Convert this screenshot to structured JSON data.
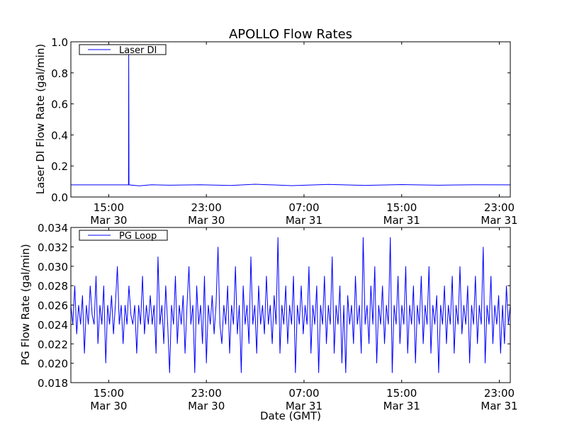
{
  "title": "APOLLO Flow Rates",
  "chart_data": [
    {
      "type": "line",
      "title": "APOLLO Flow Rates",
      "xlabel": "",
      "ylabel": "Laser DI Flow Rate (gal/min)",
      "x_unit": "hours since Mar 30 00:00 GMT",
      "xlim": [
        11.9,
        47.9
      ],
      "ylim": [
        0.0,
        1.0
      ],
      "yticks": [
        "0.0",
        "0.2",
        "0.4",
        "0.6",
        "0.8",
        "1.0"
      ],
      "xticks": [
        {
          "x": 15,
          "time": "15:00",
          "date": "Mar 30"
        },
        {
          "x": 23,
          "time": "23:00",
          "date": "Mar 30"
        },
        {
          "x": 31,
          "time": "07:00",
          "date": "Mar 31"
        },
        {
          "x": 39,
          "time": "15:00",
          "date": "Mar 31"
        },
        {
          "x": 47,
          "time": "23:00",
          "date": "Mar 31"
        }
      ],
      "legend": {
        "label": "Laser DI",
        "position": "top-left"
      },
      "color": "#0000ff",
      "points": [
        [
          11.9,
          0.078
        ],
        [
          16.62,
          0.078
        ],
        [
          16.64,
          0.93
        ],
        [
          16.66,
          0.078
        ],
        [
          17.5,
          0.072
        ],
        [
          18.5,
          0.079
        ],
        [
          20.0,
          0.076
        ],
        [
          22.5,
          0.079
        ],
        [
          25.0,
          0.074
        ],
        [
          27.0,
          0.082
        ],
        [
          30.0,
          0.073
        ],
        [
          33.0,
          0.081
        ],
        [
          36.0,
          0.075
        ],
        [
          39.0,
          0.08
        ],
        [
          42.0,
          0.076
        ],
        [
          45.0,
          0.079
        ],
        [
          47.9,
          0.078
        ]
      ]
    },
    {
      "type": "line",
      "xlabel": "Date (GMT)",
      "ylabel": "PG Flow Rate (gal/min)",
      "x_unit": "hours since Mar 30 00:00 GMT",
      "xlim": [
        11.9,
        47.9
      ],
      "ylim": [
        0.018,
        0.034
      ],
      "yticks": [
        "0.018",
        "0.020",
        "0.022",
        "0.024",
        "0.026",
        "0.028",
        "0.030",
        "0.032",
        "0.034"
      ],
      "xticks": [
        {
          "x": 15,
          "time": "15:00",
          "date": "Mar 30"
        },
        {
          "x": 23,
          "time": "23:00",
          "date": "Mar 30"
        },
        {
          "x": 31,
          "time": "07:00",
          "date": "Mar 31"
        },
        {
          "x": 39,
          "time": "15:00",
          "date": "Mar 31"
        },
        {
          "x": 47,
          "time": "23:00",
          "date": "Mar 31"
        }
      ],
      "legend": {
        "label": "PG Loop",
        "position": "top-left"
      },
      "color": "#0000ff",
      "x_start": 11.9,
      "x_end": 47.9,
      "values": [
        0.026,
        0.024,
        0.028,
        0.023,
        0.026,
        0.024,
        0.027,
        0.021,
        0.026,
        0.024,
        0.028,
        0.025,
        0.024,
        0.029,
        0.022,
        0.026,
        0.024,
        0.028,
        0.02,
        0.026,
        0.024,
        0.027,
        0.023,
        0.026,
        0.03,
        0.024,
        0.026,
        0.022,
        0.026,
        0.024,
        0.028,
        0.025,
        0.024,
        0.026,
        0.021,
        0.026,
        0.024,
        0.029,
        0.023,
        0.026,
        0.024,
        0.027,
        0.024,
        0.026,
        0.021,
        0.031,
        0.024,
        0.026,
        0.022,
        0.028,
        0.024,
        0.019,
        0.026,
        0.024,
        0.029,
        0.022,
        0.026,
        0.024,
        0.027,
        0.021,
        0.026,
        0.03,
        0.024,
        0.026,
        0.019,
        0.028,
        0.024,
        0.026,
        0.022,
        0.029,
        0.02,
        0.026,
        0.024,
        0.027,
        0.023,
        0.026,
        0.032,
        0.024,
        0.022,
        0.026,
        0.024,
        0.028,
        0.021,
        0.026,
        0.024,
        0.03,
        0.023,
        0.026,
        0.019,
        0.028,
        0.024,
        0.026,
        0.022,
        0.031,
        0.024,
        0.026,
        0.021,
        0.028,
        0.024,
        0.026,
        0.023,
        0.029,
        0.024,
        0.026,
        0.022,
        0.027,
        0.024,
        0.033,
        0.021,
        0.026,
        0.024,
        0.028,
        0.022,
        0.026,
        0.024,
        0.029,
        0.019,
        0.026,
        0.024,
        0.028,
        0.023,
        0.026,
        0.024,
        0.03,
        0.021,
        0.026,
        0.024,
        0.028,
        0.019,
        0.026,
        0.024,
        0.029,
        0.022,
        0.026,
        0.024,
        0.031,
        0.021,
        0.026,
        0.024,
        0.028,
        0.02,
        0.026,
        0.019,
        0.027,
        0.024,
        0.026,
        0.022,
        0.029,
        0.024,
        0.026,
        0.021,
        0.033,
        0.024,
        0.026,
        0.022,
        0.028,
        0.024,
        0.03,
        0.02,
        0.026,
        0.024,
        0.028,
        0.022,
        0.026,
        0.024,
        0.033,
        0.019,
        0.026,
        0.024,
        0.029,
        0.022,
        0.026,
        0.024,
        0.03,
        0.021,
        0.026,
        0.024,
        0.028,
        0.02,
        0.026,
        0.024,
        0.029,
        0.022,
        0.026,
        0.024,
        0.03,
        0.021,
        0.026,
        0.024,
        0.027,
        0.019,
        0.026,
        0.024,
        0.028,
        0.022,
        0.026,
        0.024,
        0.029,
        0.021,
        0.026,
        0.024,
        0.03,
        0.023,
        0.026,
        0.024,
        0.028,
        0.02,
        0.026,
        0.024,
        0.029,
        0.022,
        0.026,
        0.024,
        0.032,
        0.02,
        0.026,
        0.024,
        0.029,
        0.022,
        0.026,
        0.024,
        0.027,
        0.021,
        0.026,
        0.022,
        0.028,
        0.024,
        0.026
      ]
    }
  ]
}
